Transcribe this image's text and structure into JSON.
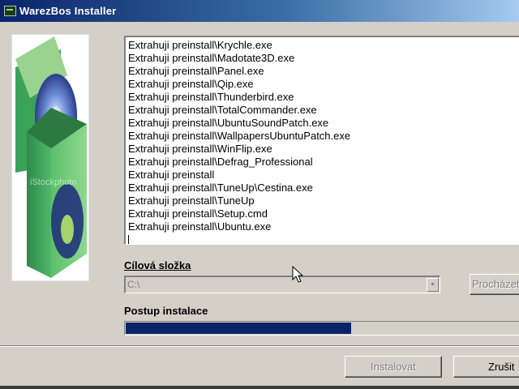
{
  "window": {
    "title": "WarezBos Installer"
  },
  "sidebar_image": {
    "watermark": "iStockphoto"
  },
  "log": {
    "lines": [
      "Extrahuji preinstall\\Krychle.exe",
      "Extrahuji preinstall\\Madotate3D.exe",
      "Extrahuji preinstall\\Panel.exe",
      "Extrahuji preinstall\\Qip.exe",
      "Extrahuji preinstall\\Thunderbird.exe",
      "Extrahuji preinstall\\TotalCommander.exe",
      "Extrahuji preinstall\\UbuntuSoundPatch.exe",
      "Extrahuji preinstall\\WallpapersUbuntuPatch.exe",
      "Extrahuji preinstall\\WinFlip.exe",
      "Extrahuji preinstall\\Defrag_Professional",
      "Extrahuji preinstall",
      "Extrahuji preinstall\\TuneUp\\Cestina.exe",
      "Extrahuji preinstall\\TuneUp",
      "Extrahuji preinstall\\Setup.cmd",
      "Extrahuji preinstall\\Ubuntu.exe"
    ]
  },
  "target": {
    "label": "Cílová složka",
    "value": "C:\\",
    "browse_label": "Procházet"
  },
  "progress": {
    "label": "Postup instalace",
    "fraction": 0.56
  },
  "buttons": {
    "install_label": "Instalovat",
    "cancel_label": "Zrušit"
  },
  "colors": {
    "titlebar": "#0a246a",
    "progress_fill": "#0a246a",
    "face": "#d4d0c8"
  }
}
